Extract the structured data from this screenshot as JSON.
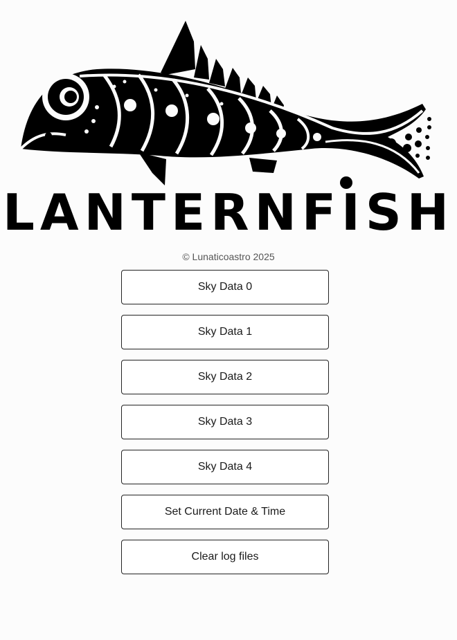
{
  "logo": {
    "wordmark": "LANTERNFISH",
    "color": "#000000"
  },
  "footer": {
    "copyright": "© Lunaticoastro 2025"
  },
  "buttons": [
    {
      "label": "Sky Data 0"
    },
    {
      "label": "Sky Data 1"
    },
    {
      "label": "Sky Data 2"
    },
    {
      "label": "Sky Data 3"
    },
    {
      "label": "Sky Data 4"
    },
    {
      "label": "Set Current Date & Time"
    },
    {
      "label": "Clear log files"
    }
  ]
}
